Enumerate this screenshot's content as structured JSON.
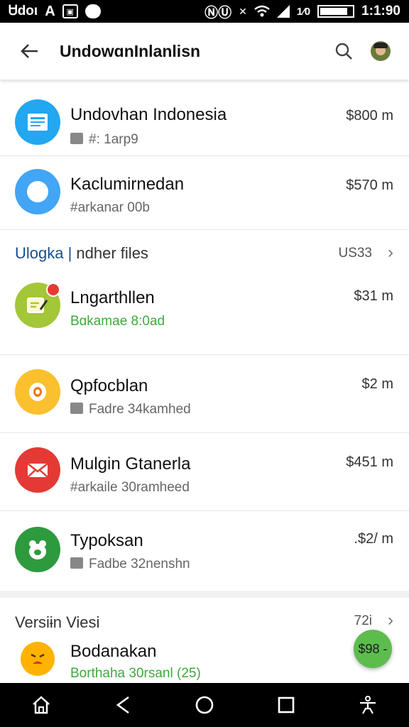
{
  "status_bar": {
    "left_text": "Ꮜdoι",
    "left_glyph": "A",
    "right_icons": [
      "nfc-icon",
      "mute-icon",
      "wifi-icon",
      "signal-icon",
      "battery-icon"
    ],
    "battery_text": "1⁄0",
    "time": "1:1:90"
  },
  "app_bar": {
    "title": "UndowɑnInlanlisn",
    "back_icon": "arrow-back-icon",
    "search_icon": "search-icon",
    "avatar_icon": "user-avatar"
  },
  "list_top": [
    {
      "title": "Undovhan Indonesia",
      "subtitle": "#: 1arp9",
      "price": "$800 m",
      "icon_color": "#22a7f0",
      "icon": "document-icon",
      "sub_icon": true,
      "sub_green": false
    },
    {
      "title": "Kaclumirnedan",
      "subtitle": "#arkanar 00b",
      "price": "$570 m",
      "icon_color": "#42a5f5",
      "icon": "compass-icon",
      "sub_icon": false,
      "sub_green": false
    }
  ],
  "section1": {
    "title_prefix": "Ulogka |",
    "title_rest": " ndher files",
    "right": "US33",
    "chevron_icon": "chevron-right-icon"
  },
  "list_mid": [
    {
      "title": "Lngarthllen",
      "subtitle": "Bɑkamae 8:0ad",
      "price": "$31 m",
      "icon_color": "#a4c639",
      "icon": "note-edit-icon",
      "badge": true,
      "sub_icon": false,
      "sub_green": true
    },
    {
      "title": "Qpfocblan",
      "subtitle": "Fadre 34kamhed",
      "price": "$2 m",
      "icon_color": "#fbc02d",
      "icon": "egg-icon",
      "badge": false,
      "sub_icon": true,
      "sub_green": false
    },
    {
      "title": "Mulgin Gtanerla",
      "subtitle": "#arkaile 30ramheed",
      "price": "$451 m",
      "icon_color": "#e53935",
      "icon": "mail-icon",
      "badge": false,
      "sub_icon": false,
      "sub_green": false
    },
    {
      "title": "Typoksan",
      "subtitle": "Fadbe 32nenshn",
      "price": ".$2/ m",
      "icon_color": "#2e9a3e",
      "icon": "frog-icon",
      "badge": false,
      "sub_icon": true,
      "sub_green": false
    }
  ],
  "section2": {
    "title": "Versiɨn Viesi",
    "right": "72i",
    "chevron_icon": "chevron-right-icon"
  },
  "list_bottom": [
    {
      "title": "Bodanakan",
      "subtitle": "Borthaha 30rsanl (25)",
      "price": "$",
      "icon_color": "#ffb300",
      "icon": "emoji-icon",
      "sub_green": true
    }
  ],
  "fab": {
    "label": "$98 -",
    "icon": "price-tag-icon"
  },
  "nav_bar": [
    "home-icon",
    "back-icon",
    "circle-home-icon",
    "recents-icon",
    "accessibility-icon"
  ]
}
